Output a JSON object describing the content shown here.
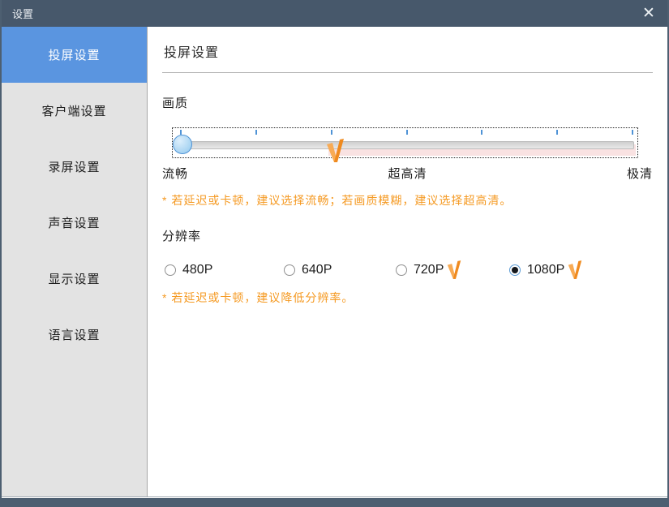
{
  "window": {
    "title": "设置",
    "close_label": "✕"
  },
  "colors": {
    "titlebar": "#47586b",
    "sidebar_bg": "#e3e3e3",
    "selected_item_blue": "#5a95e0",
    "accent_blue": "#4f93d6",
    "warning_orange": "#f59a23",
    "warning_pink": "#f9e2e2",
    "vip_orange_light": "#f8ab55",
    "vip_orange_dark": "#ef8a1f"
  },
  "sidebar": {
    "items": [
      {
        "label": "投屏设置",
        "selected": true
      },
      {
        "label": "客户端设置",
        "selected": false
      },
      {
        "label": "录屏设置",
        "selected": false
      },
      {
        "label": "声音设置",
        "selected": false
      },
      {
        "label": "显示设置",
        "selected": false
      },
      {
        "label": "语言设置",
        "selected": false
      }
    ]
  },
  "main": {
    "heading": "投屏设置",
    "quality": {
      "label": "画质",
      "slider_value": "流畅",
      "tick_count": 7,
      "vip_threshold_label": "超高清",
      "slider_labels": {
        "left": "流畅",
        "middle": "超高清",
        "right": "极清"
      },
      "note": "* 若延迟或卡顿，建议选择流畅；若画质模糊，建议选择超高清。"
    },
    "resolution": {
      "label": "分辨率",
      "selected_value": "1080P",
      "options": [
        {
          "label": "480P",
          "selected": false,
          "vip": false
        },
        {
          "label": "640P",
          "selected": false,
          "vip": false
        },
        {
          "label": "720P",
          "selected": false,
          "vip": true
        },
        {
          "label": "1080P",
          "selected": true,
          "vip": true
        }
      ],
      "note": "* 若延迟或卡顿，建议降低分辨率。"
    }
  }
}
